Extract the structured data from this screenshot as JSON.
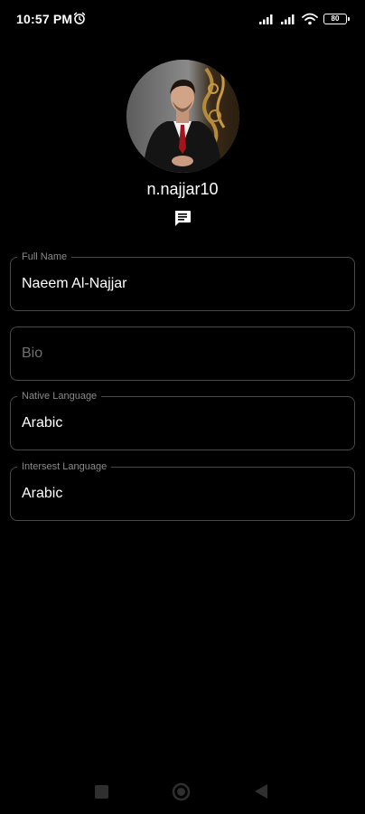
{
  "status_bar": {
    "time": "10:57 PM",
    "battery_level": "80",
    "icons": [
      "alarm-icon",
      "signal-icon",
      "signal-icon",
      "wifi-icon",
      "battery-icon"
    ]
  },
  "profile": {
    "username": "n.najjar10",
    "avatar_icon": "profile-photo",
    "message_icon": "chat-icon"
  },
  "form": {
    "full_name": {
      "label": "Full Name",
      "value": "Naeem Al-Najjar"
    },
    "bio": {
      "placeholder": "Bio",
      "value": ""
    },
    "native_language": {
      "label": "Native Language",
      "value": "Arabic"
    },
    "interest_language": {
      "label": "Intersest Language",
      "value": "Arabic"
    }
  },
  "navigation": {
    "icons": [
      "recents-icon",
      "home-icon",
      "back-icon"
    ]
  },
  "colors": {
    "background": "#000000",
    "text": "#ffffff",
    "label": "#8a8a8a",
    "border": "#4a4a4a"
  }
}
